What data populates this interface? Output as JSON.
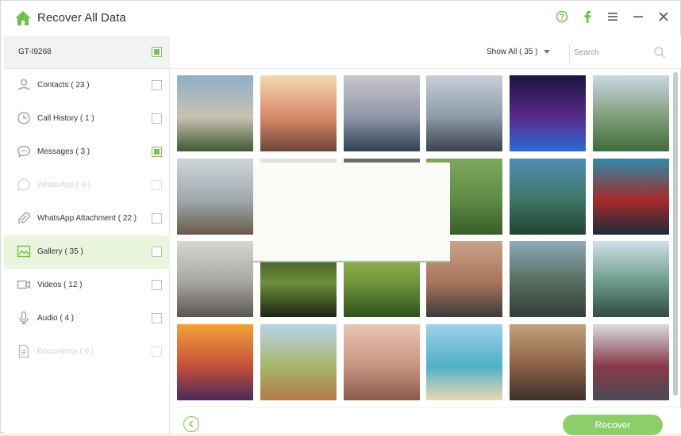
{
  "app": {
    "title": "Recover All Data"
  },
  "titlebar": {
    "icons": [
      "help-icon",
      "facebook-icon",
      "menu-icon",
      "minimize-icon",
      "close-icon"
    ]
  },
  "colors": {
    "accent": "#7cbf5b",
    "active_bg": "#e9f6dd",
    "button": "#8ccf6a"
  },
  "device": {
    "name": "GT-I9268",
    "checked": true
  },
  "sidebar": {
    "items": [
      {
        "label": "Contacts ( 23 )",
        "icon": "contacts-icon",
        "checked": false,
        "faded": false,
        "active": false
      },
      {
        "label": "Call History ( 1 )",
        "icon": "clock-icon",
        "checked": false,
        "faded": false,
        "active": false
      },
      {
        "label": "Messages ( 3 )",
        "icon": "message-icon",
        "checked": true,
        "faded": false,
        "active": false
      },
      {
        "label": "WhatsApp ( 0 )",
        "icon": "whatsapp-icon",
        "checked": false,
        "faded": true,
        "active": false
      },
      {
        "label": "WhatsApp Attachment ( 22 )",
        "icon": "paperclip-icon",
        "checked": false,
        "faded": false,
        "active": false
      },
      {
        "label": "Gallery ( 35 )",
        "icon": "gallery-icon",
        "checked": false,
        "faded": false,
        "active": true
      },
      {
        "label": "Videos ( 12 )",
        "icon": "video-icon",
        "checked": false,
        "faded": false,
        "active": false
      },
      {
        "label": "Audio ( 4 )",
        "icon": "microphone-icon",
        "checked": false,
        "faded": false,
        "active": false
      },
      {
        "label": "Documents ( 0 )",
        "icon": "document-icon",
        "checked": false,
        "faded": true,
        "active": false
      }
    ]
  },
  "filter": {
    "label": "Show All ( 35 )"
  },
  "search": {
    "placeholder": "Search",
    "value": ""
  },
  "photos": [
    {
      "name": "house-photo",
      "colors": [
        "#8fb0c9",
        "#c9c1b3",
        "#3f5a32"
      ]
    },
    {
      "name": "cliff-sunset-photo",
      "colors": [
        "#f3d8b0",
        "#d9896a",
        "#6b4636"
      ]
    },
    {
      "name": "lake-mountains-photo",
      "colors": [
        "#c9c7cf",
        "#8e95a6",
        "#2f4156"
      ]
    },
    {
      "name": "city-tower-photo",
      "colors": [
        "#c7cfd9",
        "#8e9aa8",
        "#3a434e"
      ]
    },
    {
      "name": "neon-city-photo",
      "colors": [
        "#1a1540",
        "#5a2a8a",
        "#2b6bd6"
      ]
    },
    {
      "name": "river-valley-photo",
      "colors": [
        "#cbd8e3",
        "#7f9d78",
        "#3f6b3c"
      ]
    },
    {
      "name": "family-beach-photo",
      "colors": [
        "#cfd6d9",
        "#9ea8ad",
        "#6b5a4c"
      ]
    },
    {
      "name": "hidden-photo-1",
      "colors": [
        "#e8e2d6",
        "#c9bfae",
        "#9a8f7e"
      ]
    },
    {
      "name": "hidden-photo-2",
      "colors": [
        "#6b6f6a",
        "#4c5548",
        "#2d3528"
      ]
    },
    {
      "name": "picnic-photo",
      "colors": [
        "#7fa85c",
        "#5d8a45",
        "#3a5d2a"
      ]
    },
    {
      "name": "forest-lake-photo",
      "colors": [
        "#4f8fb5",
        "#3f7566",
        "#22432f"
      ]
    },
    {
      "name": "iron-man-photo",
      "colors": [
        "#2f8aa8",
        "#a52a2a",
        "#1e2a3a"
      ]
    },
    {
      "name": "beach-walk-photo",
      "colors": [
        "#d7d6d2",
        "#a7a5a0",
        "#5a5550"
      ]
    },
    {
      "name": "crystal-ball-photo",
      "colors": [
        "#2f3a24",
        "#6c8f3a",
        "#1b2414"
      ]
    },
    {
      "name": "rice-terrace-photo",
      "colors": [
        "#a9c45a",
        "#6f963a",
        "#2f4f1e"
      ]
    },
    {
      "name": "desert-road-photo",
      "colors": [
        "#c9a48c",
        "#a8735a",
        "#3d3a3a"
      ]
    },
    {
      "name": "winding-river-photo",
      "colors": [
        "#8ea9bb",
        "#556b5c",
        "#2f3d36"
      ]
    },
    {
      "name": "karst-lake-photo",
      "colors": [
        "#d0e0ea",
        "#6a9a86",
        "#2e4b44"
      ]
    },
    {
      "name": "balloons-sunset-photo",
      "colors": [
        "#f2a33a",
        "#c5503a",
        "#4a2a5a"
      ]
    },
    {
      "name": "dirt-road-photo",
      "colors": [
        "#b7d4ec",
        "#a8b56a",
        "#b27a4a"
      ]
    },
    {
      "name": "baby-feet-photo",
      "colors": [
        "#e8c7b4",
        "#c99480",
        "#8a5a4a"
      ]
    },
    {
      "name": "beach-family-photo",
      "colors": [
        "#9fd0e8",
        "#4fb0c9",
        "#e9d7b0"
      ]
    },
    {
      "name": "toys-photo",
      "colors": [
        "#c3a27a",
        "#8a6048",
        "#3d2f28"
      ]
    },
    {
      "name": "child-hat-photo",
      "colors": [
        "#d9dde0",
        "#8a3a4a",
        "#4a4a55"
      ]
    }
  ],
  "footer": {
    "recover_label": "Recover"
  }
}
